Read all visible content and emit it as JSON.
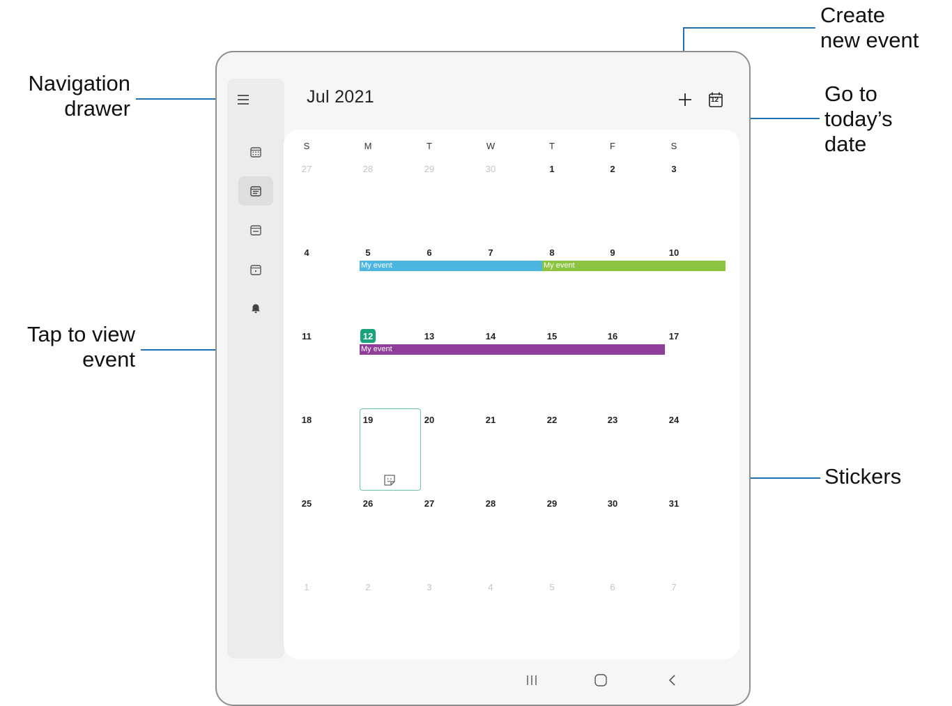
{
  "callouts": {
    "navigation_drawer": [
      "Navigation",
      "drawer"
    ],
    "create_new_event": [
      "Create",
      "new event"
    ],
    "go_to_today": [
      "Go to",
      "today’s",
      "date"
    ],
    "tap_to_view_event": [
      "Tap to view",
      "event"
    ],
    "stickers": "Stickers"
  },
  "header": {
    "month": "Jul 2021",
    "today_icon_number": "12"
  },
  "weekdays": [
    "S",
    "M",
    "T",
    "W",
    "T",
    "F",
    "S"
  ],
  "weeks": [
    [
      "27",
      "28",
      "29",
      "30",
      "1",
      "2",
      "3"
    ],
    [
      "4",
      "5",
      "6",
      "7",
      "8",
      "9",
      "10"
    ],
    [
      "11",
      "12",
      "13",
      "14",
      "15",
      "16",
      "17"
    ],
    [
      "18",
      "19",
      "20",
      "21",
      "22",
      "23",
      "24"
    ],
    [
      "25",
      "26",
      "27",
      "28",
      "29",
      "30",
      "31"
    ],
    [
      "1",
      "2",
      "3",
      "4",
      "5",
      "6",
      "7"
    ]
  ],
  "today": "12",
  "events": [
    {
      "label": "My event",
      "color": "#4cb6e0"
    },
    {
      "label": "My event",
      "color": "#8cc43f"
    },
    {
      "label": "My event",
      "color": "#8f3d98"
    }
  ],
  "sidebar_icons": [
    "year-view-icon",
    "month-view-icon",
    "week-view-icon",
    "day-view-icon",
    "reminder-bell-icon"
  ],
  "nav_icons": [
    "recent-apps-icon",
    "home-icon",
    "back-icon"
  ],
  "colors": {
    "accent": "#1aa37a",
    "callout_line": "#1f6fb5"
  }
}
